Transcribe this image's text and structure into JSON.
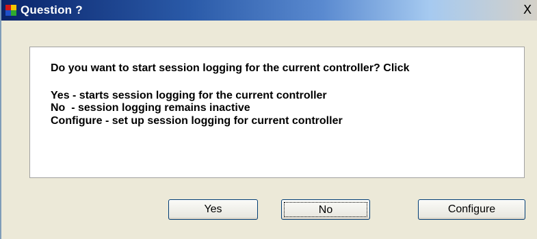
{
  "window": {
    "title": "Question ?",
    "close_symbol": "X",
    "title_icon": "app-window-icon"
  },
  "message": {
    "line1": "Do you want to start session logging for the current controller? Click",
    "line2": "Yes - starts session logging for the current controller",
    "line3": "No  - session logging remains inactive",
    "line4": "Configure - set up session logging for current controller"
  },
  "buttons": {
    "yes_label": "Yes",
    "no_label": "No",
    "configure_label": "Configure"
  },
  "colors": {
    "titlebar_start": "#0a246a",
    "titlebar_end": "#a6caf0",
    "dialog_background": "#ece9d8",
    "button_border": "#003c74"
  }
}
